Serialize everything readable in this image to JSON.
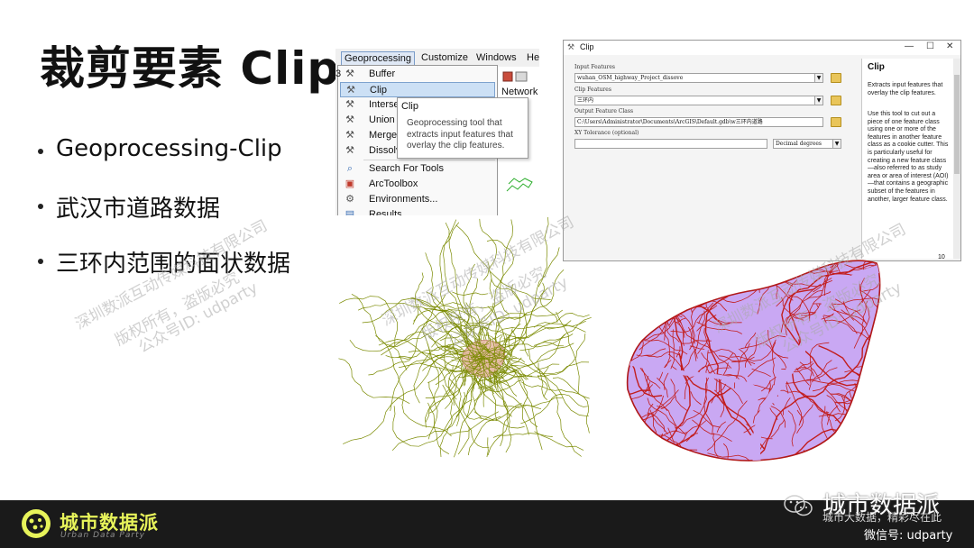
{
  "slide": {
    "title": "裁剪要素 Clip",
    "bullets": [
      "Geoprocessing-Clip",
      "武汉市道路数据",
      "三环内范围的面状数据"
    ]
  },
  "arcmap": {
    "menubar": [
      "Geoprocessing",
      "Customize",
      "Windows",
      "He"
    ],
    "left_digit": "3",
    "network_label": "Network",
    "menu_items": [
      {
        "label": "Buffer",
        "icon": "hammer-icon"
      },
      {
        "label": "Clip",
        "icon": "hammer-icon",
        "highlighted": true
      },
      {
        "label": "Interse",
        "icon": "hammer-icon"
      },
      {
        "label": "Union",
        "icon": "hammer-icon"
      },
      {
        "label": "Merge",
        "icon": "hammer-icon"
      },
      {
        "label": "Dissolv",
        "icon": "hammer-icon"
      },
      {
        "label": "Search For Tools",
        "icon": "search-tools-icon"
      },
      {
        "label": "ArcToolbox",
        "icon": "toolbox-icon"
      },
      {
        "label": "Environments...",
        "icon": "environments-icon"
      },
      {
        "label": "Results",
        "icon": "results-icon"
      }
    ],
    "tooltip": {
      "title": "Clip",
      "body": "Geoprocessing tool that extracts input features that overlay the clip features."
    }
  },
  "clip_dialog": {
    "title": "Clip",
    "window_buttons": [
      "—",
      "☐",
      "✕"
    ],
    "fields": [
      {
        "label": "Input Features",
        "value": "wuhan_OSM_highway_Project_dissove",
        "kind": "combo"
      },
      {
        "label": "Clip Features",
        "value": "三环内",
        "kind": "combo"
      },
      {
        "label": "Output Feature Class",
        "value": "C:\\Users\\Administrator\\Documents\\ArcGIS\\Default.gdb\\w三环内道路",
        "kind": "text"
      },
      {
        "label": "XY Tolerance (optional)",
        "value": "",
        "unit": "Decimal degrees",
        "kind": "tolerance"
      }
    ],
    "help": {
      "title": "Clip",
      "p1": "Extracts input features that overlay the clip features.",
      "p2": "Use this tool to cut out a piece of one feature class using one or more of the features in another feature class as a cookie cutter. This is particularly useful for creating a new feature class—also referred to as study area or area of interest (AOI)—that contains a geographic subset of the features in another, larger feature class."
    },
    "bottom_right": "10"
  },
  "maps": {
    "left_road_color": "#7a8a00",
    "left_area_color": "#e8b7a6",
    "right_fill_color": "#c9a8f3",
    "right_road_color": "#c21d1d"
  },
  "watermarks": [
    "深圳数派互动传媒科技有限公司",
    "版权所有，盗版必究",
    "公众号ID: udparty"
  ],
  "footer": {
    "brand_cn": "城市数据派",
    "brand_en": "Urban Data Party",
    "wechat_name": "城市数据派",
    "slogan": "城市大数据，精彩尽在此",
    "wechat_id": "微信号: udparty"
  },
  "colors": {
    "brand_yellow": "#e7f35a",
    "footer_bg": "#1a1a1a",
    "menu_highlight": "#cce0f5"
  }
}
